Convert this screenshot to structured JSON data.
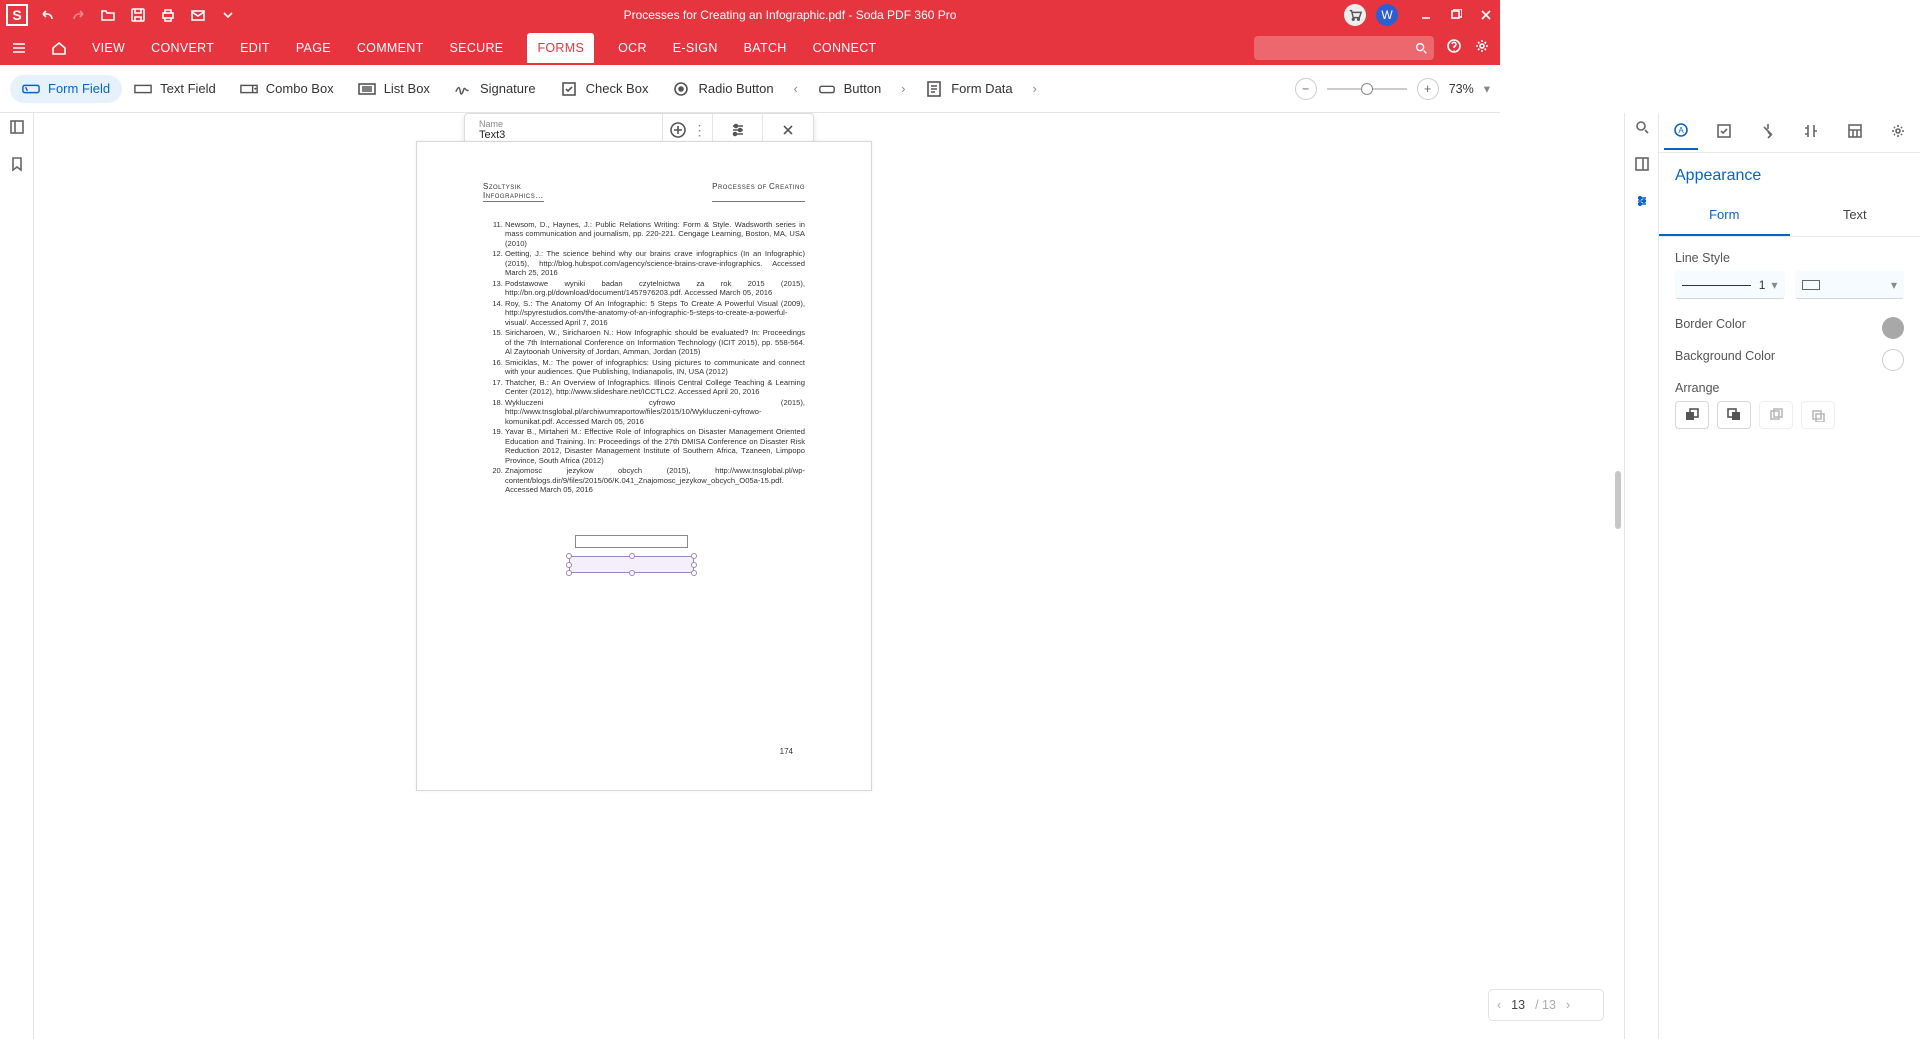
{
  "title": "Processes for Creating an Infographic.pdf  -  Soda PDF 360 Pro",
  "avatar": "W",
  "menus": [
    "VIEW",
    "CONVERT",
    "EDIT",
    "PAGE",
    "COMMENT",
    "SECURE",
    "FORMS",
    "OCR",
    "E-SIGN",
    "BATCH",
    "CONNECT"
  ],
  "menu_active": "FORMS",
  "tools": {
    "form_field": "Form Field",
    "text_field": "Text Field",
    "combo_box": "Combo Box",
    "list_box": "List Box",
    "signature": "Signature",
    "check_box": "Check Box",
    "radio_button": "Radio Button",
    "button": "Button",
    "form_data": "Form Data"
  },
  "zoom": "73%",
  "popover": {
    "name_label": "Name",
    "name_value": "Text3"
  },
  "page": {
    "hleft": "Szoltysik\nInfographics…",
    "hright": "Processes of Creating",
    "num": "174",
    "refs": [
      "Newsom, D., Haynes, J.: Public Relations Writing: Form & Style. Wadsworth series in mass communication and journalism, pp. 220-221. Cengage Learning, Boston, MA, USA (2010)",
      "Oetting, J.: The science behind why our brains crave infographics (In an Infographic) (2015), http://blog.hubspot.com/agency/science-brains-crave-infographics. Accessed March 25, 2016",
      "Podstawowe wyniki badan czytelnictwa za rok 2015 (2015), http://bn.org.pl/download/document/1457976203.pdf. Accessed March 05, 2016",
      "Roy, S.: The Anatomy Of An Infographic: 5 Steps To Create A Powerful Visual (2009), http://spyrestudios.com/the-anatomy-of-an-infographic-5-steps-to-create-a-powerful-visual/. Accessed April 7, 2016",
      "Siricharoen, W., Siricharoen N.: How Infographic should be evaluated? In: Proceedings of the 7th International Conference on Information Technology (ICIT 2015), pp. 558-564. Al Zaytoonah University of Jordan, Amman, Jordan (2015)",
      "Smiciklas, M.: The power of infographics: Using pictures to communicate and connect with your audiences. Que Publishing, Indianapolis, IN, USA (2012)",
      "Thatcher, B.: An Overview of Infographics. Illinois Central College Teaching & Learning Center (2012), http://www.slideshare.net/ICCTLC2. Accessed April 20, 2016",
      "Wykluczeni cyfrowo (2015), http://www.tnsglobal.pl/archiwumraportow/files/2015/10/Wykluczeni-cyfrowo-komunikat.pdf. Accessed March 05, 2016",
      "Yavar B., Mirtaheri M.: Effective Role of Infographics on Disaster Management Oriented Education and Training. In: Proceedings of the 27th DMISA Conference on Disaster Risk Reduction 2012, Disaster Management Institute of Southern Africa, Tzaneen, Limpopo Province, South Africa (2012)",
      "Znajomosc jezykow obcych (2015), http://www.tnsglobal.pl/wp-content/blogs.dir/9/files/2015/06/K.041_Znajomosc_jezykow_obcych_O05a-15.pdf. Accessed March 05, 2016"
    ]
  },
  "pagenav": {
    "current": "13",
    "total": "/ 13"
  },
  "rpanel": {
    "title": "Appearance",
    "tabs": {
      "form": "Form",
      "text": "Text"
    },
    "line_style": "Line Style",
    "line_width": "1",
    "border_color": "Border Color",
    "background_color": "Background Color",
    "arrange": "Arrange"
  }
}
